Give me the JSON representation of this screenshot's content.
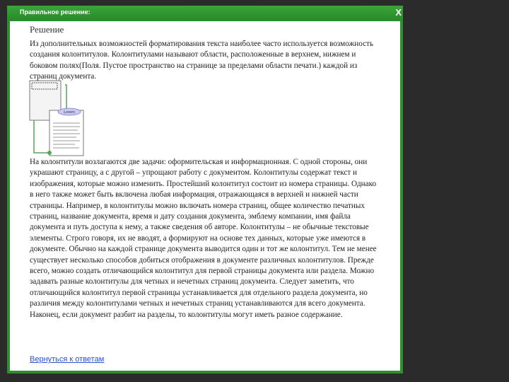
{
  "window": {
    "title": "Правильное решение:",
    "close_label": "X"
  },
  "content": {
    "heading": "Решение",
    "intro": "Из дополнительных возможностей форматирования текста наиболее часто используется возможность создания колонтитулов. Колонтитулами называют области, расположенные в верхнем, нижнем и боковом полях(Поля. Пустое пространство на странице за пределами области печати.) каждой из страниц документа.",
    "illustration_label": "Lorem",
    "body": "На колонтитули возлагаются две задачи: оформительская и информационная. С одной стороны, они украшают страницу, а с другой – упрощают работу с документом. Колонтитулы содержат текст и изображения, которые можно изменить. Простейший колонтитул состоит из номера страницы. Однако в него также может быть включена любая информация, отражающаяся в верхней и нижней части страницы. Например, в колонтитулы можно включать номера страниц, общее количество печатных страниц, название документа, время и дату создания документа, эмблему компании, имя файла документа и путь доступа к нему, а также сведения об авторе. Колонтитулы – не обычные текстовые элементы. Строго говоря, их не вводят, а формируют на основе тех данных, которые уже имеются в документе. Обычно на каждой странице документа выводится один и тот же колонтитул. Тем не менее существует несколько способов добиться отображения в документе различных колонтитулов. Прежде всего, можно создать отличающийся колонтитул для первой страницы документа или раздела. Можно задавать разные колонтитулы для четных и нечетных страниц документа. Следует заметить, что отличающийся колонтитул первой страницы устанавливается для отдельного раздела документа, но различия между колонтитулами четных и нечетных страниц устанавливаются для всего документа. Наконец, если документ разбит на разделы, то колонтитулы могут иметь разное содержание.",
    "back_link": "Вернуться к ответам"
  },
  "colors": {
    "frame": "#2f8f2f",
    "background": "#2b2b2b",
    "link": "#2a4fd0"
  }
}
